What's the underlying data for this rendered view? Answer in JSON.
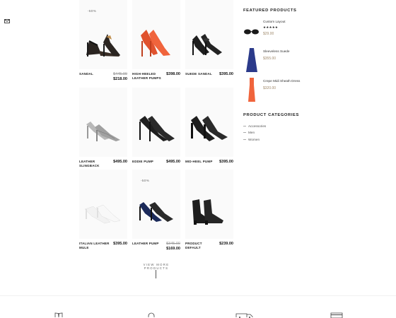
{
  "icons": {
    "mail": "mail-icon",
    "wishlist": "book-icon",
    "support": "headset-icon",
    "shipping": "truck-icon",
    "payment": "card-icon"
  },
  "colors": {
    "accent": "#a08a6c",
    "text": "#222222",
    "muted": "#999999",
    "dress_navy": "#2b3a8a",
    "dress_orange": "#f0643c"
  },
  "products": [
    {
      "name": "SANDAL",
      "old_price": "$445.00",
      "price": "$218.00",
      "badge": "-50%"
    },
    {
      "name": "HIGH-HEELED LEATHER PUMPS",
      "old_price": "",
      "price": "$398.00",
      "badge": ""
    },
    {
      "name": "SUEDE SANDAL",
      "old_price": "",
      "price": "$395.00",
      "badge": ""
    },
    {
      "name": "LEATHER SLINGBACK",
      "old_price": "",
      "price": "$495.00",
      "badge": ""
    },
    {
      "name": "EDDIE PUMP",
      "old_price": "",
      "price": "$495.00",
      "badge": ""
    },
    {
      "name": "MID-HEEL PUMP",
      "old_price": "",
      "price": "$395.00",
      "badge": ""
    },
    {
      "name": "ITALIAN LEATHER MULE",
      "old_price": "",
      "price": "$395.00",
      "badge": ""
    },
    {
      "name": "LEATHER PUMP",
      "old_price": "$345.00",
      "price": "$169.00",
      "badge": "-50%"
    },
    {
      "name": "PRODUCT DEFAULT",
      "old_price": "",
      "price": "$239.00",
      "badge": ""
    }
  ],
  "view_more": "VIEW MORE PRODUCTS",
  "sidebar": {
    "featured_title": "FEATURED PRODUCTS",
    "featured": [
      {
        "title": "Custom Layout",
        "stars": "★★★★★",
        "price": "$29.00"
      },
      {
        "title": "Sleeveless Suede",
        "price": "$355.00"
      },
      {
        "title": "Crepe Midi Sheath Dress",
        "price": "$320.00"
      }
    ],
    "categories_title": "PRODUCT CATEGORIES",
    "categories": [
      "Accessories",
      "Men",
      "Women"
    ]
  }
}
